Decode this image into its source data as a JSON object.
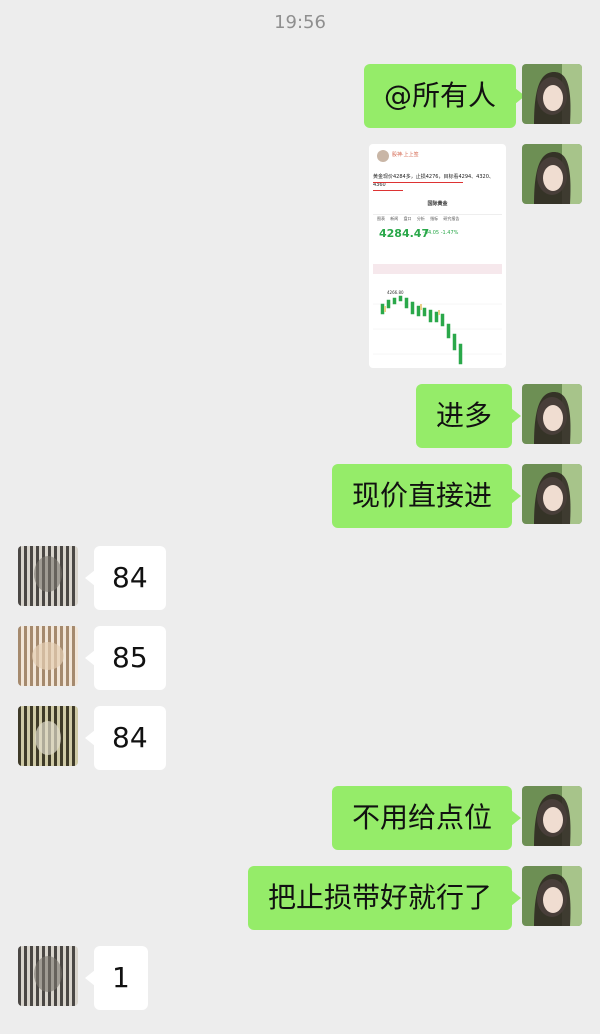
{
  "timestamp": "19:56",
  "messages": [
    {
      "sender": "me",
      "type": "text",
      "text": "@所有人"
    },
    {
      "sender": "me",
      "type": "image",
      "image": {
        "user": "股神·上上签",
        "post_text": "黄金现价4284多，止损4276，目标看4294、4320、4360",
        "instrument": "国际黄金",
        "price": "4284.47",
        "change": "-64.05  -1.47%",
        "tabs": [
          "图表",
          "新闻",
          "盘口",
          "分析",
          "指标",
          "研究报告"
        ],
        "chart_label": "4266.80"
      }
    },
    {
      "sender": "me",
      "type": "text",
      "text": "进多"
    },
    {
      "sender": "me",
      "type": "text",
      "text": "现价直接进"
    },
    {
      "sender": "other",
      "type": "text",
      "text": "84"
    },
    {
      "sender": "other",
      "type": "text",
      "text": "85"
    },
    {
      "sender": "other",
      "type": "text",
      "text": "84"
    },
    {
      "sender": "me",
      "type": "text",
      "text": "不用给点位"
    },
    {
      "sender": "me",
      "type": "text",
      "text": "把止损带好就行了"
    },
    {
      "sender": "other",
      "type": "text",
      "text": "1"
    }
  ],
  "colors": {
    "me_bubble": "#95ec69",
    "other_bubble": "#ffffff",
    "background": "#ededed",
    "bull": "#2aa84a"
  }
}
